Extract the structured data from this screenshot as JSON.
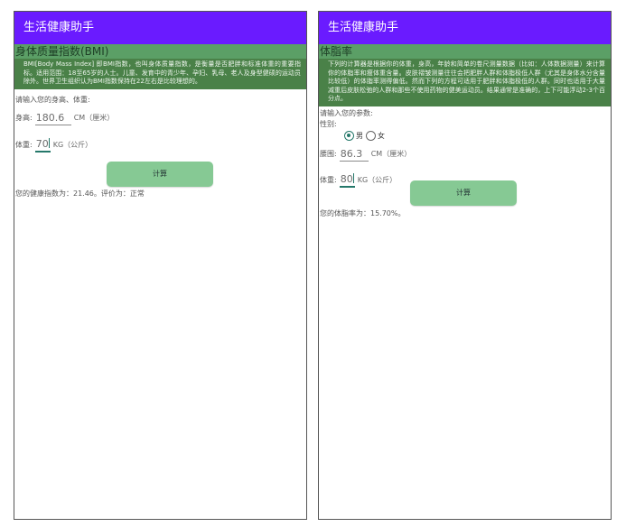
{
  "colors": {
    "appbar": "#6a1bff",
    "section_header": "#5b9f66",
    "description_bg": "#4a8148",
    "button": "#86c994",
    "accent": "#25786a"
  },
  "left": {
    "app_title": "生活健康助手",
    "section_title": "身体质量指数(BMI)",
    "description": "BMI[Body Mass Index] 即BMI指数，也叫身体质量指数，是衡量是否肥胖和标准体重的重要指标。适用范围：18至65岁的人士。儿童、发育中的青少年、孕妇、乳母、老人及身型健硕的运动员除外。世界卫生组织认为BMI指数保持在22左右是比较理想的。",
    "prompt": "请输入您的身高、体重:",
    "height_label": "身高:",
    "height_value": "180.6",
    "height_unit": "CM（厘米）",
    "weight_label": "体重:",
    "weight_value": "70",
    "weight_unit": "KG（公斤）",
    "button_label": "计算",
    "result": "您的健康指数为：21.46。评价为：正常"
  },
  "right": {
    "app_title": "生活健康助手",
    "section_title": "体脂率",
    "description": "下列的计算器是根据你的体重，身高，年龄和简单的卷尺测量数据（比如：人体数据测量）来计算你的体脂率和瘦体重含量。皮肤褶皱测量往往会把肥胖人群和体脂极低人群（尤其是身体水分含量比较低）的体脂率测得偏低。然而下列的方程可适用于肥胖和体脂极低的人群。同时也适用于大量减重后皮肤松弛的人群和那些不使用药物的健美运动员。结果通常是准确的，上下可能浮动2-3个百分点。",
    "prompt": "请输入您的参数:",
    "gender_label": "性别:",
    "gender_male": "男",
    "gender_female": "女",
    "gender_selected": "男",
    "waist_label": "腰围:",
    "waist_value": "86.3",
    "waist_unit": "CM（厘米）",
    "weight_label": "体重:",
    "weight_value": "80",
    "weight_unit": "KG（公斤）",
    "button_label": "计算",
    "result": "您的体脂率为：15.70%。"
  }
}
